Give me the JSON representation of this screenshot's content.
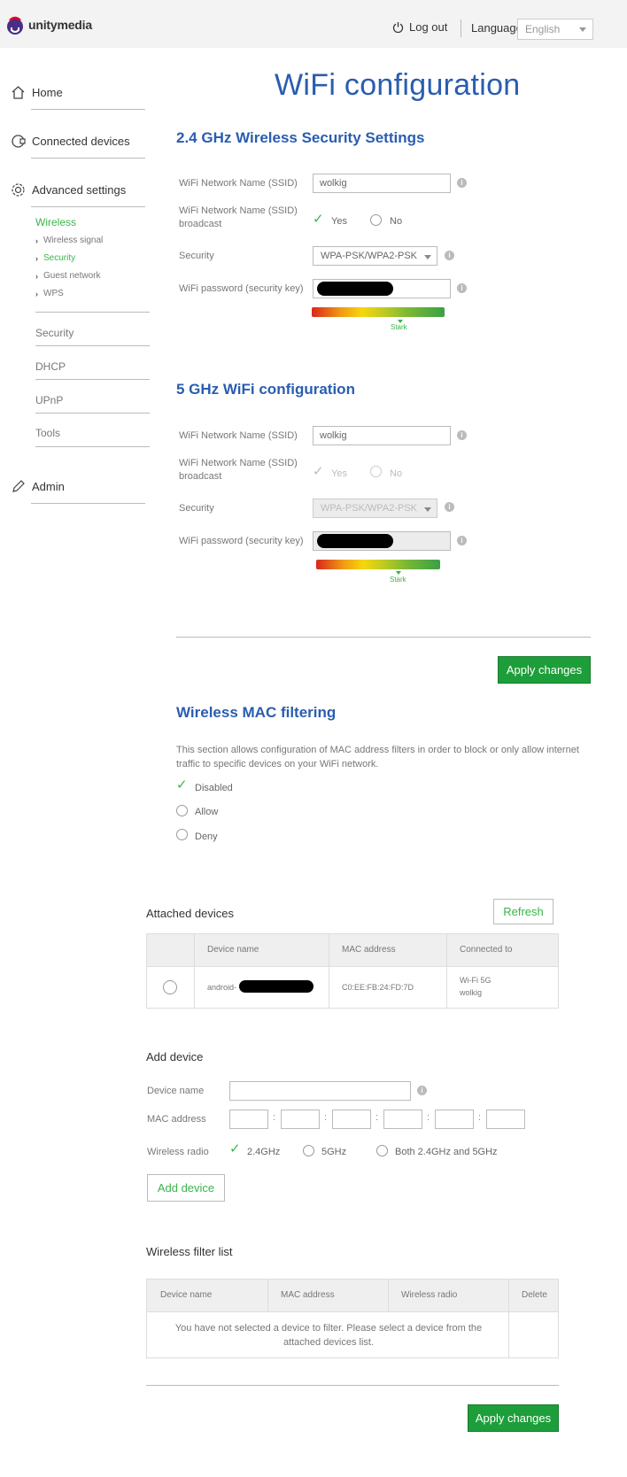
{
  "header": {
    "brand": "unitymedia",
    "logout_label": "Log out",
    "language_label": "Language",
    "language_value": "English"
  },
  "sidebar": {
    "main_items": [
      {
        "label": "Home",
        "icon": "home-icon"
      },
      {
        "label": "Connected devices",
        "icon": "devices-icon"
      },
      {
        "label": "Advanced settings",
        "icon": "gear-icon"
      }
    ],
    "wireless_label": "Wireless",
    "wireless_subitems": [
      "Wireless signal",
      "Security",
      "Guest network",
      "WPS"
    ],
    "active_subitem": "Security",
    "advanced_items": [
      "Security",
      "DHCP",
      "UPnP",
      "Tools"
    ],
    "admin_label": "Admin",
    "admin_icon": "pencil-icon"
  },
  "page": {
    "title": "WiFi configuration"
  },
  "band24": {
    "section_title": "2.4 GHz Wireless Security Settings",
    "ssid_label": "WiFi Network Name (SSID)",
    "ssid_value": "wolkig",
    "broadcast_label_line1": "WiFi Network Name (SSID)",
    "broadcast_label_line2": "broadcast",
    "yes_label": "Yes",
    "no_label": "No",
    "broadcast_value": "Yes",
    "security_label": "Security",
    "security_value": "WPA-PSK/WPA2-PSK",
    "password_label": "WiFi password (security key)",
    "strength_label": "Stark",
    "strength_level": 0.65
  },
  "band5": {
    "section_title": "5 GHz WiFi configuration",
    "ssid_label": "WiFi Network Name (SSID)",
    "ssid_value": "wolkig",
    "broadcast_label_line1": "WiFi Network Name (SSID)",
    "broadcast_label_line2": "broadcast",
    "yes_label": "Yes",
    "no_label": "No",
    "broadcast_value": "Yes",
    "security_label": "Security",
    "security_value": "WPA-PSK/WPA2-PSK",
    "password_label": "WiFi password (security key)",
    "strength_label": "Stark",
    "strength_level": 0.65
  },
  "apply_label": "Apply changes",
  "mac_filter": {
    "title": "Wireless MAC filtering",
    "description": "This section allows configuration of MAC address filters in order to block or only allow internet traffic to specific devices on your WiFi network.",
    "options": [
      "Disabled",
      "Allow",
      "Deny"
    ],
    "selected": "Disabled"
  },
  "attached": {
    "title": "Attached devices",
    "refresh_label": "Refresh",
    "columns": [
      "Device name",
      "MAC address",
      "Connected to"
    ],
    "rows": [
      {
        "device_name": "android-",
        "mac": "C0:EE:FB:24:FD:7D",
        "connected_line1": "Wi-Fi 5G",
        "connected_line2": "wolkig"
      }
    ]
  },
  "add_device": {
    "title": "Add device",
    "name_label": "Device name",
    "mac_label": "MAC address",
    "radio_label": "Wireless radio",
    "radio_options": [
      "2.4GHz",
      "5GHz",
      "Both 2.4GHz and 5GHz"
    ],
    "radio_selected": "2.4GHz",
    "button_label": "Add device"
  },
  "filter_list": {
    "title": "Wireless filter list",
    "columns": [
      "Device name",
      "MAC address",
      "Wireless radio",
      "Delete"
    ],
    "empty_message": "You have not selected a device to filter. Please select a device from the attached devices list."
  },
  "colors": {
    "brand_blue": "#2a5db0",
    "accent_green": "#3ab54a",
    "button_green": "#1e9e3a"
  }
}
